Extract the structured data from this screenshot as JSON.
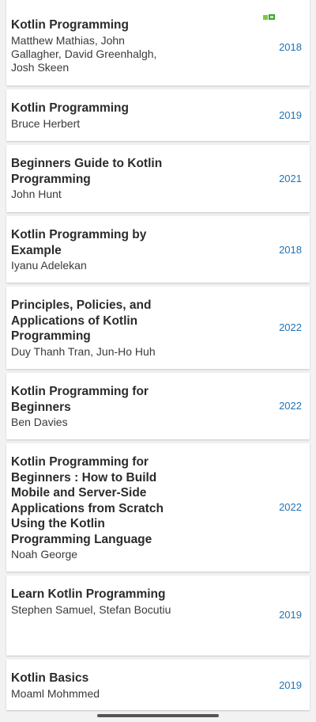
{
  "books": [
    {
      "title": "Kotlin Programming",
      "author": "Matthew Mathias, John Gallagher, David Greenhalgh, Josh Skeen",
      "year": "2018"
    },
    {
      "title": "Kotlin Programming",
      "author": "Bruce Herbert",
      "year": "2019"
    },
    {
      "title": "Beginners Guide to Kotlin Programming",
      "author": "John Hunt",
      "year": "2021"
    },
    {
      "title": "Kotlin Programming by Example",
      "author": "Iyanu Adelekan",
      "year": "2018"
    },
    {
      "title": "Principles, Policies, and Applications of Kotlin Programming",
      "author": "Duy Thanh Tran, Jun-Ho Huh",
      "year": "2022"
    },
    {
      "title": "Kotlin Programming for Beginners",
      "author": "Ben Davies",
      "year": "2022"
    },
    {
      "title": "Kotlin Programming for Beginners : How to Build Mobile and Server-Side Applications from Scratch Using the Kotlin Programming Language",
      "author": "Noah George",
      "year": "2022"
    },
    {
      "title": "Learn Kotlin Programming",
      "author": "Stephen Samuel, Stefan Bocutiu",
      "year": "2019"
    },
    {
      "title": "Kotlin Basics",
      "author": "Moaml Mohmmed",
      "year": "2019"
    }
  ],
  "icons": {
    "corner": "book-cover-icon"
  },
  "colors": {
    "year": "#1f73b7",
    "title": "#2b2b2b",
    "author": "#3a3a3a",
    "background": "#f2f2f2",
    "card": "#ffffff"
  }
}
